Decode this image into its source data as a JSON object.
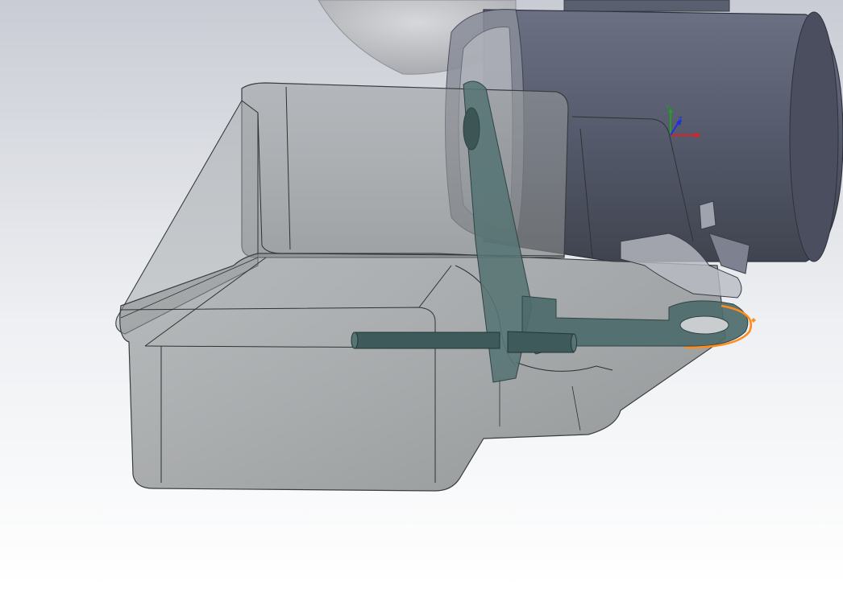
{
  "viewport": {
    "background_top": "#c9ccd4",
    "background_bottom": "#ffffff"
  },
  "model": {
    "housing_color": "#54586a",
    "housing_dark": "#3c4050",
    "housing_light": "#6b7083",
    "cover_color": "#8a8e8f",
    "cover_edge": "#3a3d3f",
    "bracket_color": "#4e6b6b",
    "bracket_edge": "#2f4444",
    "selection_color": "#ff8c1a"
  },
  "triad": {
    "x_label": "X",
    "y_label": "Y",
    "z_label": "Z",
    "x_color": "#e02020",
    "y_color": "#1fa01f",
    "z_color": "#2030e0"
  }
}
